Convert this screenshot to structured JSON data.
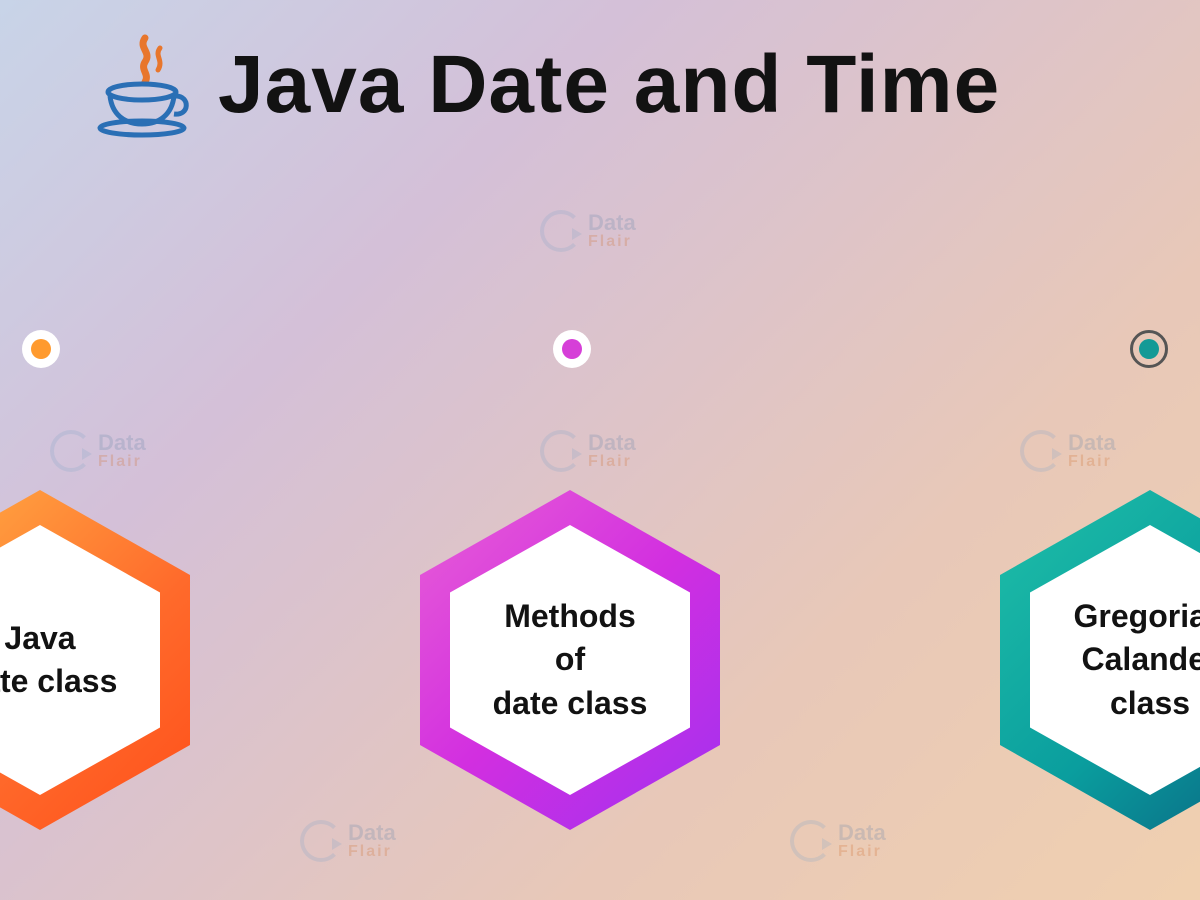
{
  "header": {
    "title": "Java Date and Time",
    "logo_name": "java-logo"
  },
  "hexagons": [
    {
      "label_line1": "Java",
      "label_line2": "date class",
      "color": "orange"
    },
    {
      "label_line1": "Methods",
      "label_line2": "of",
      "label_line3": "date class",
      "color": "magenta"
    },
    {
      "label_line1": "Gregorian",
      "label_line2": "Calander",
      "label_line3": "class",
      "color": "teal"
    }
  ],
  "dots": [
    {
      "color": "#ff9a2e"
    },
    {
      "color": "#d63fd8"
    },
    {
      "color": "#139a96"
    }
  ],
  "watermark": {
    "top": "Data",
    "bottom": "Flair"
  }
}
